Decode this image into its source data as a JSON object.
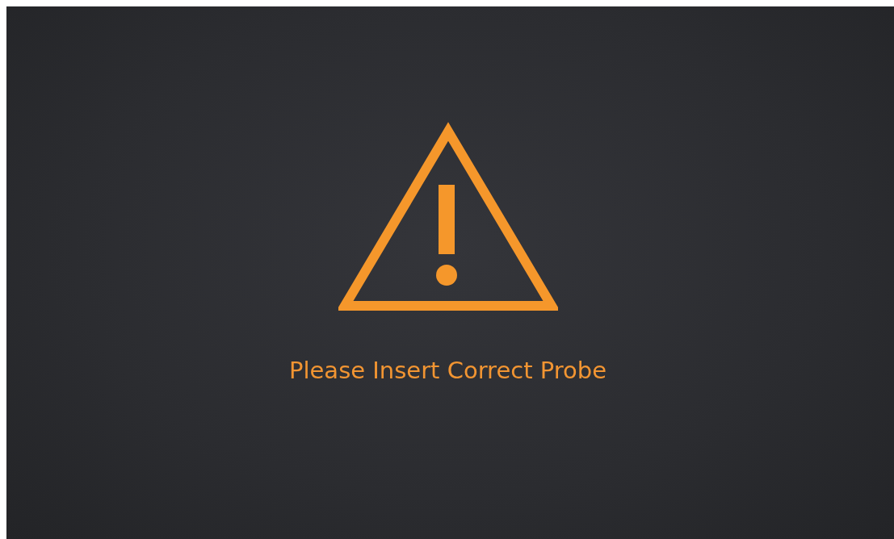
{
  "message": "Please Insert Correct Probe"
}
